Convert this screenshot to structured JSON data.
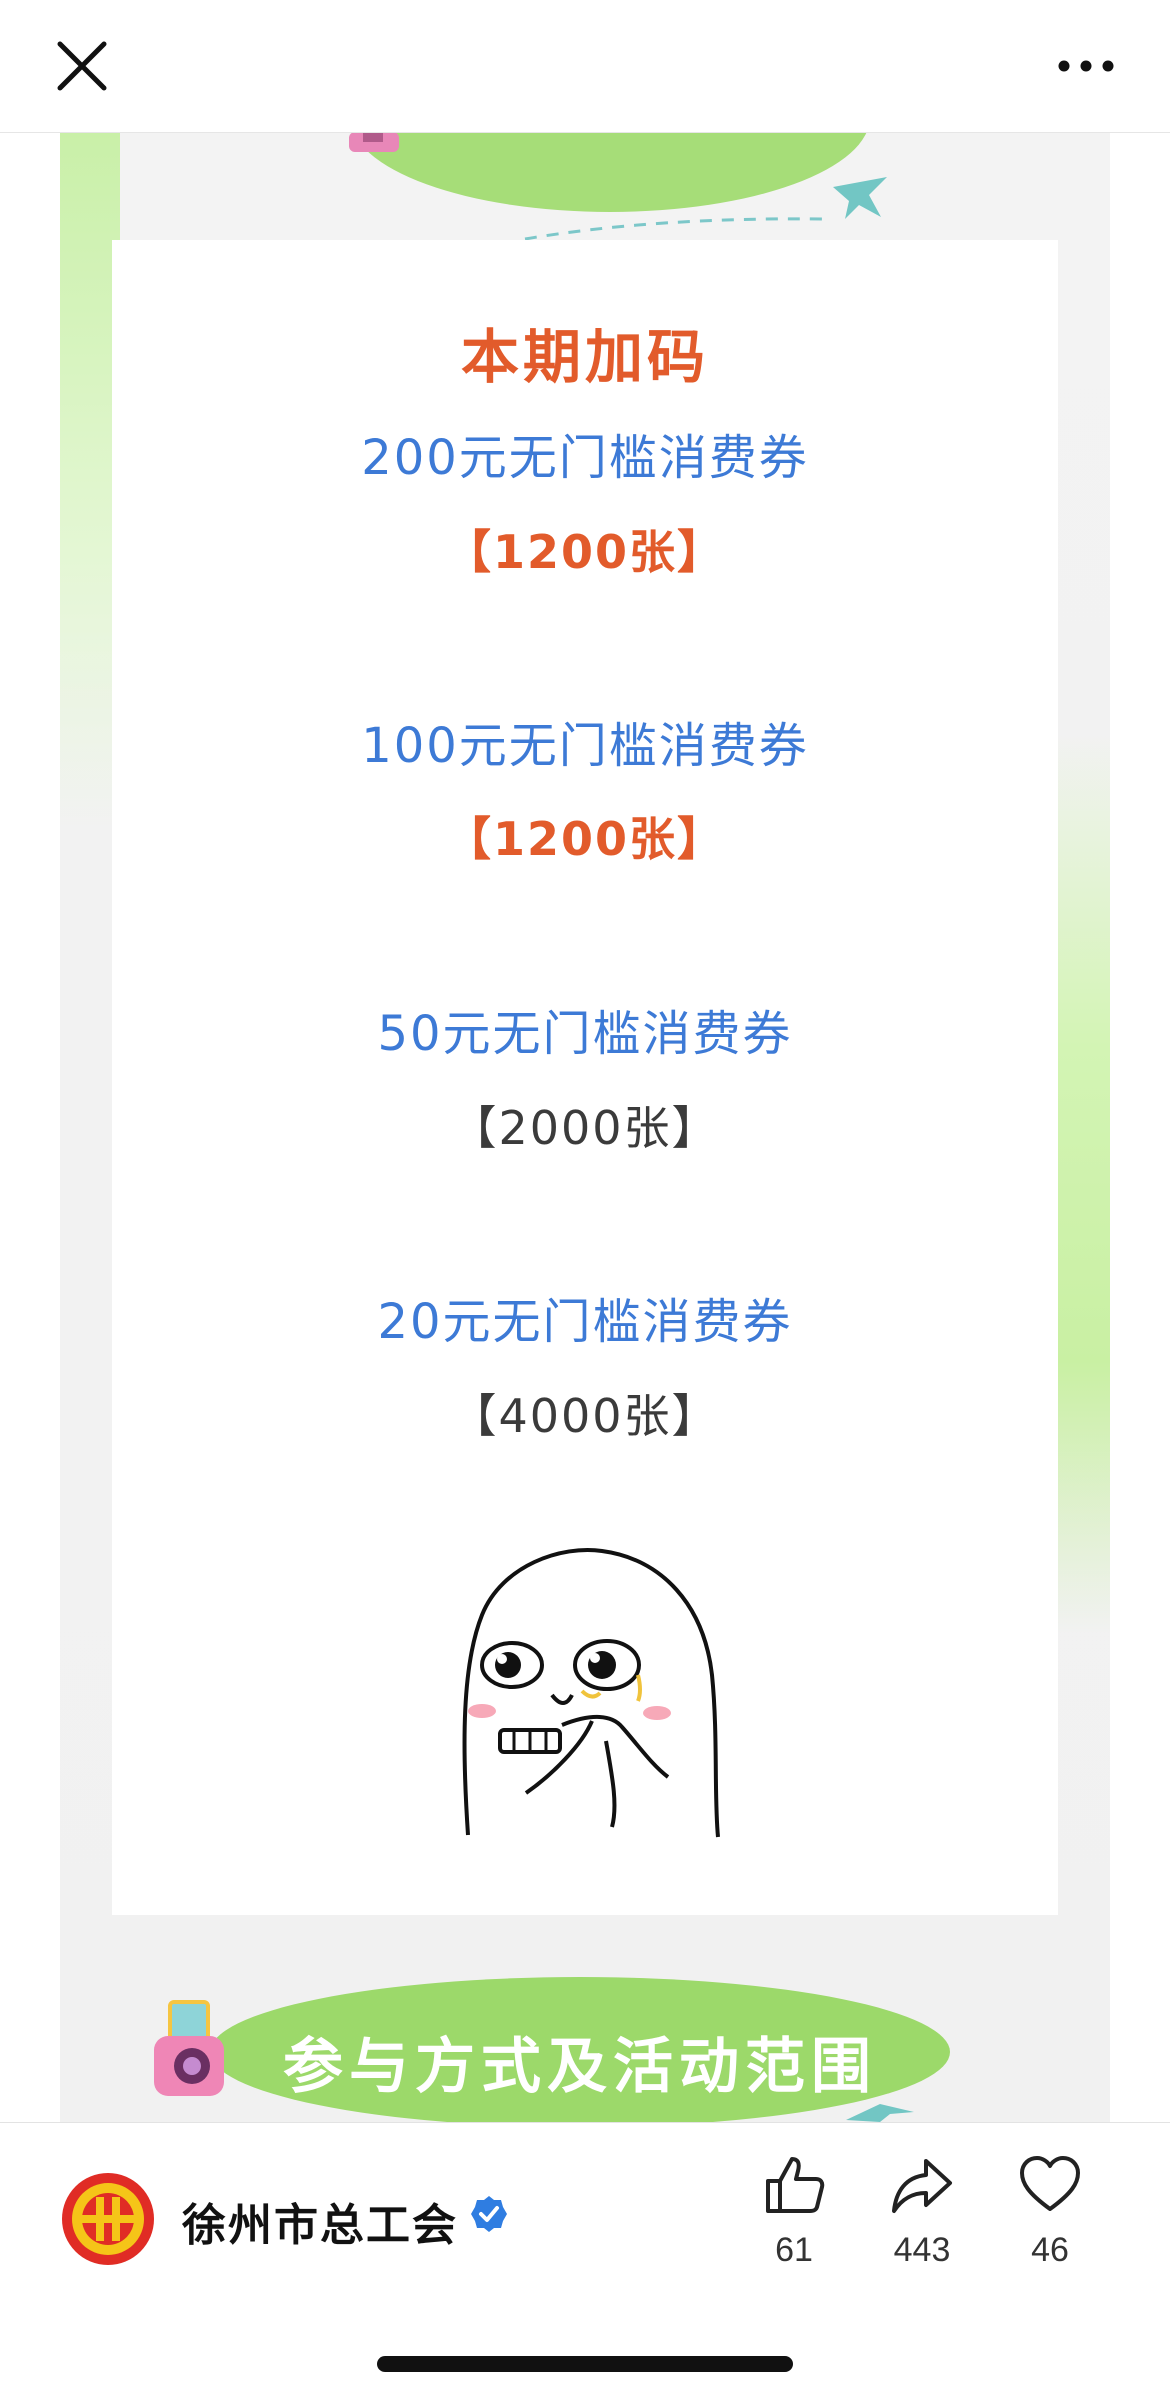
{
  "card": {
    "title": "本期加码",
    "coupons": [
      {
        "name": "200元无门槛消费券",
        "quantity": "【1200张】"
      },
      {
        "name": "100元无门槛消费券",
        "quantity": "【1200张】"
      },
      {
        "name": "50元无门槛消费券",
        "quantity": "【2000张】"
      },
      {
        "name": "20元无门槛消费券",
        "quantity": "【4000张】"
      }
    ]
  },
  "section_header": "参与方式及活动范围",
  "account": {
    "name": "徐州市总工会"
  },
  "actions": {
    "like_count": "61",
    "share_count": "443",
    "favorite_count": "46"
  },
  "colors": {
    "accent_orange": "#e25b2b",
    "link_blue": "#3d7ad6",
    "pill_green": "#9cd96a",
    "verified_blue": "#2f7de1"
  }
}
